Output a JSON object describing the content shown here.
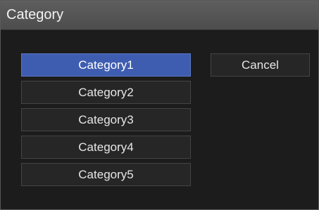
{
  "dialog": {
    "title": "Category",
    "selected_index": 0,
    "selected_color": "#3f5db0"
  },
  "categories": [
    {
      "label": "Category1"
    },
    {
      "label": "Category2"
    },
    {
      "label": "Category3"
    },
    {
      "label": "Category4"
    },
    {
      "label": "Category5"
    }
  ],
  "cancel_label": "Cancel"
}
